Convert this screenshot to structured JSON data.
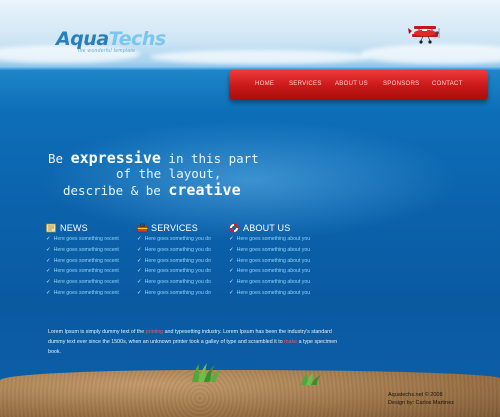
{
  "logo": {
    "part1": "Aqua",
    "part2": "Techs",
    "tagline": "the wonderful template"
  },
  "nav": {
    "items": [
      "Home",
      "Services",
      "About us",
      "Sponsors",
      "Contact"
    ]
  },
  "headline": {
    "line1": {
      "pre": "Be ",
      "emph": "expressive",
      "post": " in this part"
    },
    "line2": "of the layout,",
    "line3": {
      "pre": "describe & be ",
      "emph": "creative"
    }
  },
  "columns": [
    {
      "title": "NEWS",
      "icon": "newspaper-icon",
      "items": [
        "Here goes something recent",
        "Here goes something recent",
        "Here goes something recent",
        "Here goes something recent",
        "Here goes something recent",
        "Here goes something recent"
      ]
    },
    {
      "title": "SERVICES",
      "icon": "toolbox-icon",
      "items": [
        "Here goes something you do",
        "Here goes something you do",
        "Here goes something you do",
        "Here goes something you do",
        "Here goes something you do",
        "Here goes something you do"
      ]
    },
    {
      "title": "ABOUT US",
      "icon": "lifebuoy-icon",
      "items": [
        "Here goes something about you",
        "Here goes something about you",
        "Here goes something about you",
        "Here goes something about you",
        "Here goes something about you",
        "Here goes something about you"
      ]
    }
  ],
  "body_text": {
    "part1": "Lorem Ipsum is simply dummy text of the ",
    "link1": "printing",
    "part2": " and typesetting industry. Lorem Ipsum has been the industry's standard dummy text ever since the 1500s, when an unknown printer took a galley of type and scrambled it to ",
    "link2": "make",
    "part3": " a type specimen book."
  },
  "footer": {
    "line1": "Aquatechs.net © 2008",
    "line2": "Design by: Carlos Martinez"
  },
  "colors": {
    "nav_red": "#d31f1f",
    "sea_blue": "#0b63ac",
    "sky": "#eaf4fb",
    "sand": "#9c7347",
    "accent_red": "#ff5252"
  }
}
